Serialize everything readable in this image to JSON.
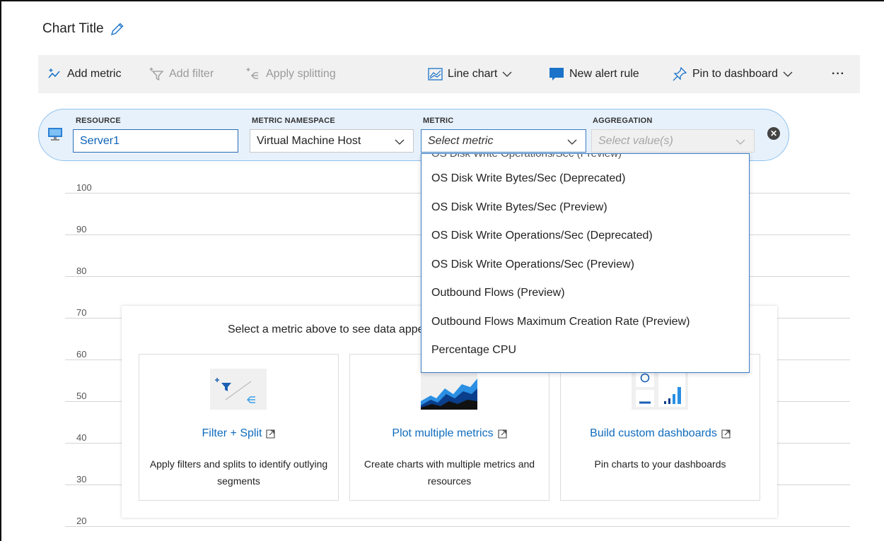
{
  "chart": {
    "title": "Chart Title"
  },
  "toolbar": {
    "add_metric": "Add metric",
    "add_filter": "Add filter",
    "apply_splitting": "Apply splitting",
    "line_chart": "Line chart",
    "new_alert_rule": "New alert rule",
    "pin_to_dashboard": "Pin to dashboard",
    "more": "···"
  },
  "picker": {
    "resource_label": "RESOURCE",
    "resource_value": "Server1",
    "namespace_label": "METRIC NAMESPACE",
    "namespace_value": "Virtual Machine Host",
    "metric_label": "METRIC",
    "metric_placeholder": "Select metric",
    "aggregation_label": "AGGREGATION",
    "aggregation_placeholder": "Select value(s)"
  },
  "axis": {
    "ticks": [
      "100",
      "90",
      "80",
      "70",
      "60",
      "50",
      "40",
      "30",
      "20"
    ]
  },
  "dropdown": {
    "clipped_item": "OS Disk Write Operations/Sec (Preview)",
    "items": [
      "OS Disk Write Bytes/Sec (Deprecated)",
      "OS Disk Write Bytes/Sec (Preview)",
      "OS Disk Write Operations/Sec (Deprecated)",
      "OS Disk Write Operations/Sec (Preview)",
      "Outbound Flows (Preview)",
      "Outbound Flows Maximum Creation Rate (Preview)",
      "Percentage CPU"
    ]
  },
  "empty_state": {
    "message": "Select a metric above to see data appear on this chart",
    "cards": [
      {
        "link": "Filter + Split",
        "desc": "Apply filters and splits to identify outlying segments"
      },
      {
        "link": "Plot multiple metrics",
        "desc": "Create charts with multiple metrics and resources"
      },
      {
        "link": "Build custom dashboards",
        "desc": "Pin charts to your dashboards"
      }
    ]
  },
  "colors": {
    "accent": "#0f6cbd",
    "picker_bg": "#e7f1fb",
    "toolbar_bg": "#f1f1f1"
  }
}
